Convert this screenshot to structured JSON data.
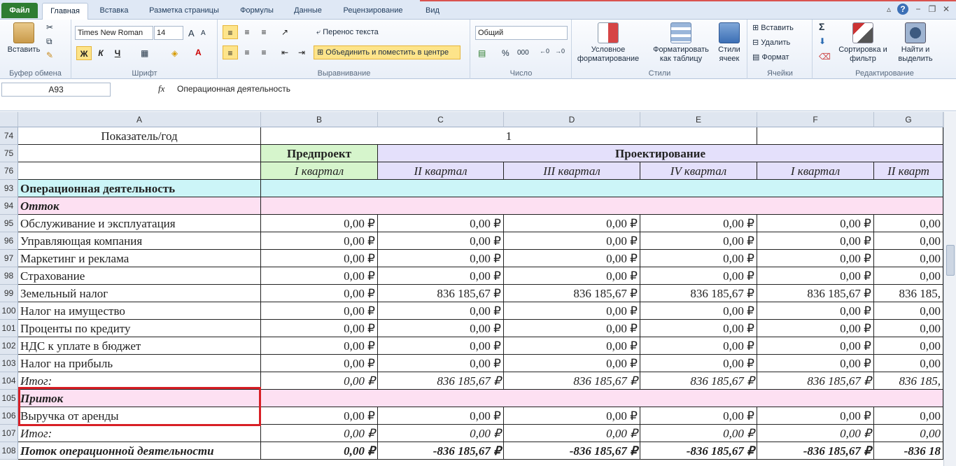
{
  "tabs": {
    "file": "Файл",
    "home": "Главная",
    "insert": "Вставка",
    "page_layout": "Разметка страницы",
    "formulas": "Формулы",
    "data": "Данные",
    "review": "Рецензирование",
    "view": "Вид"
  },
  "ribbon": {
    "clipboard": {
      "paste": "Вставить",
      "label": "Буфер обмена"
    },
    "font": {
      "name": "Times New Roman",
      "size": "14",
      "bold": "Ж",
      "italic": "К",
      "underline": "Ч",
      "label": "Шрифт"
    },
    "alignment": {
      "wrap": "Перенос текста",
      "merge": "Объединить и поместить в центре",
      "label": "Выравнивание"
    },
    "number": {
      "format": "Общий",
      "percent": "%",
      "thousands": "000",
      "label": "Число"
    },
    "styles": {
      "conditional": "Условное форматирование",
      "format_table": "Форматировать как таблицу",
      "cell_styles": "Стили ячеек",
      "label": "Стили"
    },
    "cells": {
      "insert": "Вставить",
      "delete": "Удалить",
      "format": "Формат",
      "label": "Ячейки"
    },
    "editing": {
      "sort": "Сортировка и фильтр",
      "find": "Найти и выделить",
      "label": "Редактирование"
    }
  },
  "formula_bar": {
    "name_box": "A93",
    "fx": "fx",
    "content": "Операционная деятельность"
  },
  "columns": [
    "A",
    "B",
    "C",
    "D",
    "E",
    "F",
    "G"
  ],
  "header_rows": {
    "r74": {
      "num": "74",
      "a": "Показатель/год",
      "bcde": "1"
    },
    "r75": {
      "num": "75",
      "b": "Предпроект",
      "rest": "Проектирование"
    },
    "r76": {
      "num": "76",
      "b": "I квартал",
      "c": "II квартал",
      "d": "III квартал",
      "e": "IV квартал",
      "f": "I квартал",
      "g": "II кварт"
    }
  },
  "section_rows": {
    "r93": {
      "num": "93",
      "label": "Операционная деятельность"
    },
    "r94": {
      "num": "94",
      "label": "Отток"
    },
    "r105": {
      "num": "105",
      "label": "Приток"
    }
  },
  "data_rows": [
    {
      "num": "95",
      "label": "Обслуживание и эксплуатация",
      "b": "0,00 ₽",
      "c": "0,00 ₽",
      "d": "0,00 ₽",
      "e": "0,00 ₽",
      "f": "0,00 ₽",
      "g": "0,00"
    },
    {
      "num": "96",
      "label": "Управляющая компания",
      "b": "0,00 ₽",
      "c": "0,00 ₽",
      "d": "0,00 ₽",
      "e": "0,00 ₽",
      "f": "0,00 ₽",
      "g": "0,00"
    },
    {
      "num": "97",
      "label": "Маркетинг и реклама",
      "b": "0,00 ₽",
      "c": "0,00 ₽",
      "d": "0,00 ₽",
      "e": "0,00 ₽",
      "f": "0,00 ₽",
      "g": "0,00"
    },
    {
      "num": "98",
      "label": "Страхование",
      "b": "0,00 ₽",
      "c": "0,00 ₽",
      "d": "0,00 ₽",
      "e": "0,00 ₽",
      "f": "0,00 ₽",
      "g": "0,00"
    },
    {
      "num": "99",
      "label": "Земельный налог",
      "b": "0,00 ₽",
      "c": "836 185,67 ₽",
      "d": "836 185,67 ₽",
      "e": "836 185,67 ₽",
      "f": "836 185,67 ₽",
      "g": "836 185,"
    },
    {
      "num": "100",
      "label": "Налог на имущество",
      "b": "0,00 ₽",
      "c": "0,00 ₽",
      "d": "0,00 ₽",
      "e": "0,00 ₽",
      "f": "0,00 ₽",
      "g": "0,00"
    },
    {
      "num": "101",
      "label": "Проценты по кредиту",
      "b": "0,00 ₽",
      "c": "0,00 ₽",
      "d": "0,00 ₽",
      "e": "0,00 ₽",
      "f": "0,00 ₽",
      "g": "0,00"
    },
    {
      "num": "102",
      "label": "НДС к уплате в бюджет",
      "b": "0,00 ₽",
      "c": "0,00 ₽",
      "d": "0,00 ₽",
      "e": "0,00 ₽",
      "f": "0,00 ₽",
      "g": "0,00"
    },
    {
      "num": "103",
      "label": "Налог на прибыль",
      "b": "0,00 ₽",
      "c": "0,00 ₽",
      "d": "0,00 ₽",
      "e": "0,00 ₽",
      "f": "0,00 ₽",
      "g": "0,00"
    }
  ],
  "total_out": {
    "num": "104",
    "label": "Итог:",
    "b": "0,00 ₽",
    "c": "836 185,67 ₽",
    "d": "836 185,67 ₽",
    "e": "836 185,67 ₽",
    "f": "836 185,67 ₽",
    "g": "836 185,"
  },
  "revenue": {
    "num": "106",
    "label": "Выручка от аренды",
    "b": "0,00 ₽",
    "c": "0,00 ₽",
    "d": "0,00 ₽",
    "e": "0,00 ₽",
    "f": "0,00 ₽",
    "g": "0,00"
  },
  "total_in": {
    "num": "107",
    "label": "Итог:",
    "b": "0,00 ₽",
    "c": "0,00 ₽",
    "d": "0,00 ₽",
    "e": "0,00 ₽",
    "f": "0,00 ₽",
    "g": "0,00"
  },
  "flow": {
    "num": "108",
    "label": "Поток операционной деятельности",
    "b": "0,00 ₽",
    "c": "-836 185,67 ₽",
    "d": "-836 185,67 ₽",
    "e": "-836 185,67 ₽",
    "f": "-836 185,67 ₽",
    "g": "-836 18"
  },
  "colors": {
    "predproekt": "#d6f5cc",
    "proektirovanie": "#e4e0fb",
    "section": "#ccf5f8",
    "subsection": "#fde0f2",
    "highlight": "#d81f26"
  }
}
